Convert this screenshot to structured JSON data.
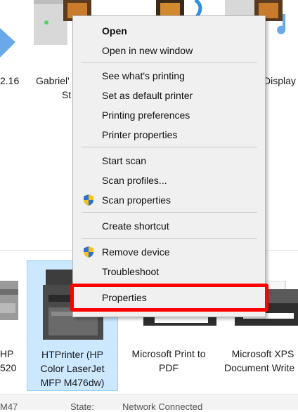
{
  "devices_top": [
    {
      "label": "2.16"
    },
    {
      "label_line1": "Gabriel'",
      "label_line2": "St"
    },
    {
      "label": "Display"
    }
  ],
  "devices_bottom": [
    {
      "label_line1": "HP",
      "label_line2": "520"
    },
    {
      "label_line1": "HTPrinter (HP",
      "label_line2": "Color LaserJet",
      "label_line3": "MFP M476dw)"
    },
    {
      "label_line1": "Microsoft Print to",
      "label_line2": "PDF"
    },
    {
      "label_line1": "Microsoft XPS",
      "label_line2": "Document Write"
    }
  ],
  "status_bar": {
    "model": "M47",
    "state_label": "State:",
    "state_value": "Network Connected"
  },
  "context_menu": {
    "open": "Open",
    "open_new_window": "Open in new window",
    "see_whats_printing": "See what's printing",
    "set_default_printer": "Set as default printer",
    "printing_preferences": "Printing preferences",
    "printer_properties": "Printer properties",
    "start_scan": "Start scan",
    "scan_profiles": "Scan profiles...",
    "scan_properties": "Scan properties",
    "create_shortcut": "Create shortcut",
    "remove_device": "Remove device",
    "troubleshoot": "Troubleshoot",
    "properties": "Properties"
  },
  "colors": {
    "highlight_box": "#ff0000",
    "selection_fill": "#cce8ff",
    "menu_background": "#f0f0f0",
    "shield_blue": "#2f6fd6",
    "shield_yellow": "#f4c21b"
  }
}
